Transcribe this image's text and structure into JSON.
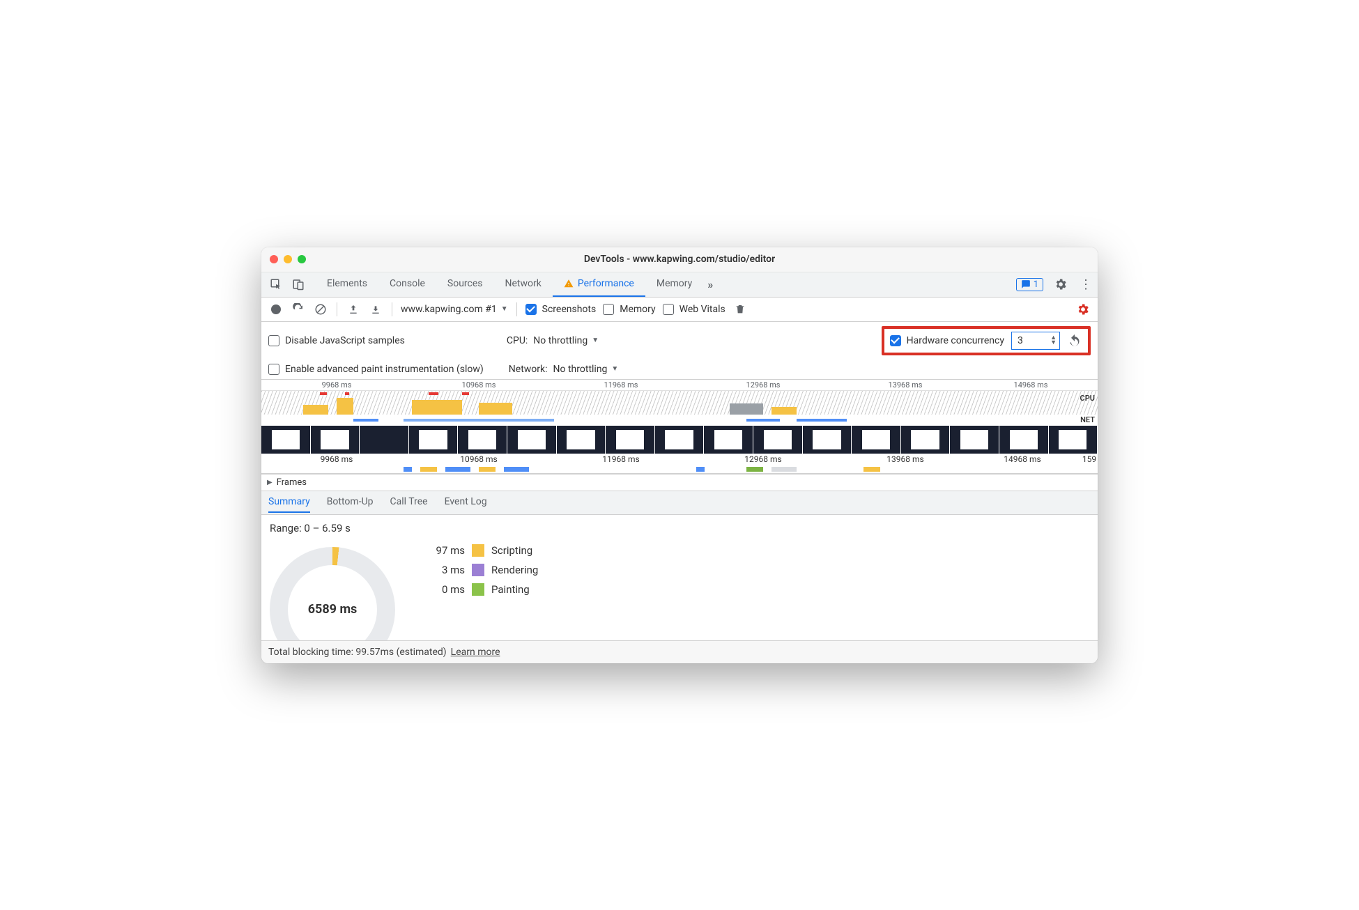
{
  "window": {
    "title": "DevTools - www.kapwing.com/studio/editor"
  },
  "tabs": {
    "items": [
      "Elements",
      "Console",
      "Sources",
      "Network",
      "Performance",
      "Memory"
    ],
    "active": "Performance",
    "badge_count": "1"
  },
  "toolbar": {
    "target": "www.kapwing.com #1",
    "screenshots_label": "Screenshots",
    "memory_label": "Memory",
    "webvitals_label": "Web Vitals"
  },
  "options": {
    "disable_js_label": "Disable JavaScript samples",
    "cpu_label": "CPU:",
    "cpu_value": "No throttling",
    "hw_label": "Hardware concurrency",
    "hw_value": "3",
    "paint_label": "Enable advanced paint instrumentation (slow)",
    "net_label": "Network:",
    "net_value": "No throttling"
  },
  "timeline": {
    "ticks": [
      "9968 ms",
      "10968 ms",
      "11968 ms",
      "12968 ms",
      "13968 ms",
      "14968 ms"
    ],
    "ticks2": [
      "9968 ms",
      "10968 ms",
      "11968 ms",
      "12968 ms",
      "13968 ms",
      "14968 ms",
      "159"
    ],
    "cpu_label": "CPU",
    "net_label": "NET",
    "frames_label": "Frames"
  },
  "subtabs": {
    "items": [
      "Summary",
      "Bottom-Up",
      "Call Tree",
      "Event Log"
    ],
    "active": "Summary"
  },
  "summary": {
    "range_label": "Range: 0 – 6.59 s",
    "total": "6589 ms",
    "legend": [
      {
        "ms": "97 ms",
        "label": "Scripting",
        "cls": "sw-script"
      },
      {
        "ms": "3 ms",
        "label": "Rendering",
        "cls": "sw-render"
      },
      {
        "ms": "0 ms",
        "label": "Painting",
        "cls": "sw-paint"
      }
    ]
  },
  "footer": {
    "text": "Total blocking time: 99.57ms (estimated)",
    "link": "Learn more"
  }
}
